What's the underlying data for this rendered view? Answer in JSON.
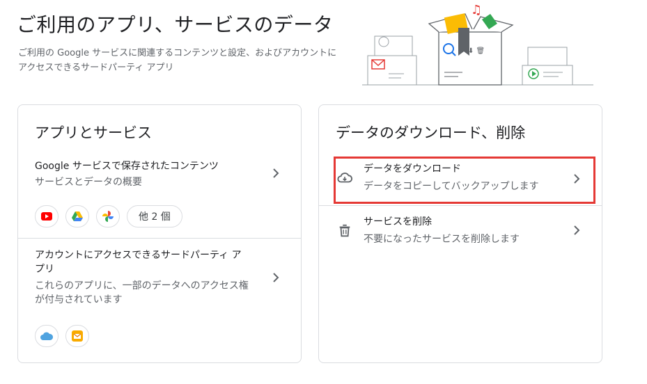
{
  "header": {
    "title": "ご利用のアプリ、サービスのデータ",
    "description": "ご利用の Google サービスに関連するコンテンツと設定、およびアカウントにアクセスできるサードパーティ アプリ"
  },
  "apps_card": {
    "title": "アプリとサービス",
    "google_content": {
      "title": "Google サービスで保存されたコンテンツ",
      "subtitle": "サービスとデータの概要",
      "chips": [
        "youtube-icon",
        "google-drive-icon",
        "google-photos-icon"
      ],
      "more_label": "他 2 個"
    },
    "third_party": {
      "title": "アカウントにアクセスできるサードパーティ アプリ",
      "subtitle": "これらのアプリに、一部のデータへのアクセス権が付与されています",
      "chips": [
        "cloud-app-icon",
        "mail-app-icon"
      ]
    }
  },
  "data_card": {
    "title": "データのダウンロード、削除",
    "download": {
      "title": "データをダウンロード",
      "subtitle": "データをコピーしてバックアップします",
      "icon": "cloud-download-icon"
    },
    "delete": {
      "title": "サービスを削除",
      "subtitle": "不要になったサービスを削除します",
      "icon": "trash-icon"
    }
  },
  "colors": {
    "highlight": "#e53935",
    "border": "#dadce0",
    "youtube": "#ff0000",
    "accent_blue": "#1a73e8"
  }
}
